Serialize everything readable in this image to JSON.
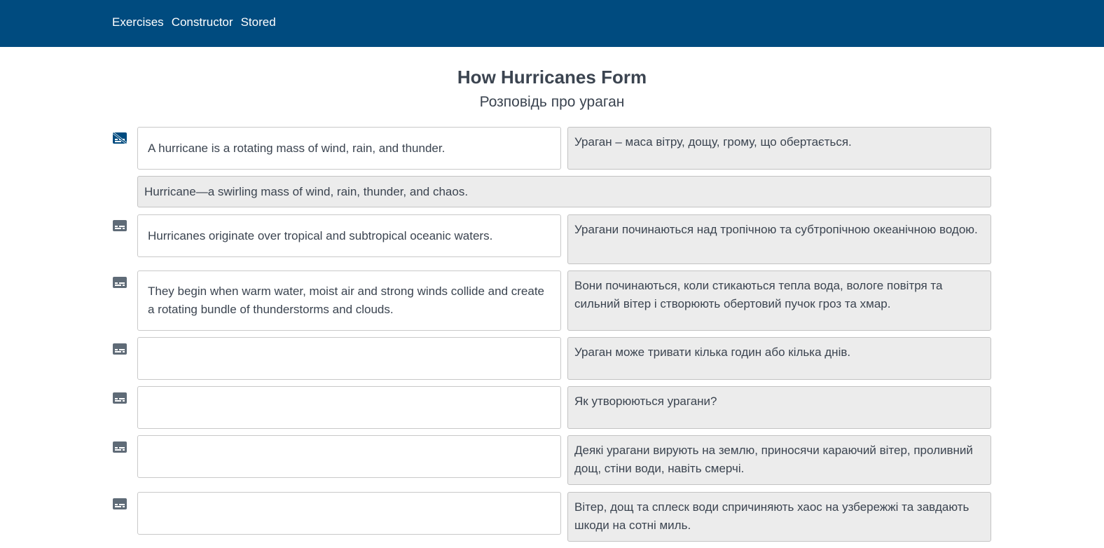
{
  "nav": {
    "links": [
      "Exercises",
      "Constructor",
      "Stored"
    ]
  },
  "header": {
    "title": "How Hurricanes Form",
    "subtitle": "Розповідь про ураган"
  },
  "icons": {
    "hide": "subtitles-off-icon",
    "show": "subtitles-icon",
    "color": "#5f6b77",
    "active_color": "#004b7f"
  },
  "rows": [
    {
      "source": "A hurricane is a rotating mass of wind, rain, and thunder.",
      "translation": "Ураган – маса вітру, дощу, грому, що обертається.",
      "alternative": "Hurricane—a swirling mass of wind, rain, thunder, and chaos."
    },
    {
      "source": "Hurricanes originate over tropical and subtropical oceanic waters.",
      "translation": "Урагани починаються над тропічною та субтропічною океанічною водою."
    },
    {
      "source": "They begin when warm water, moist air and strong winds collide and create a rotating bundle of thunderstorms and clouds.",
      "translation": "Вони починаються, коли стикаються тепла вода, вологе повітря та сильний вітер і створюють обертовий пучок гроз та хмар."
    },
    {
      "source": "",
      "translation": "Ураган може тривати кілька годин або кілька днів."
    },
    {
      "source": "",
      "translation": "Як утворюються урагани?"
    },
    {
      "source": "",
      "translation": "Деякі урагани вирують на землю, приносячи караючий вітер, проливний дощ, стіни води, навіть смерчі."
    },
    {
      "source": "",
      "translation": "Вітер, дощ та сплеск води спричиняють хаос на узбережжі та завдають шкоди на сотні миль."
    }
  ]
}
